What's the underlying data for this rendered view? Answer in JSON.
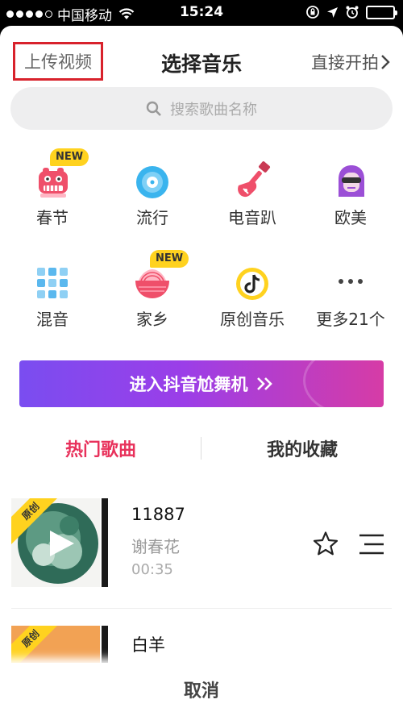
{
  "status_bar": {
    "carrier": "中国移动",
    "time": "15:24"
  },
  "header": {
    "upload_label": "上传视频",
    "title": "选择音乐",
    "direct_shoot_label": "直接开拍"
  },
  "search": {
    "placeholder": "搜索歌曲名称"
  },
  "categories": [
    {
      "label": "春节",
      "badge": "NEW",
      "icon": "lion-dance-icon"
    },
    {
      "label": "流行",
      "badge": "",
      "icon": "vinyl-record-icon"
    },
    {
      "label": "电音趴",
      "badge": "",
      "icon": "electric-guitar-icon"
    },
    {
      "label": "欧美",
      "badge": "",
      "icon": "masked-girl-icon"
    },
    {
      "label": "混音",
      "badge": "",
      "icon": "mixer-pads-icon"
    },
    {
      "label": "家乡",
      "badge": "NEW",
      "icon": "noodle-bowl-icon"
    },
    {
      "label": "原创音乐",
      "badge": "",
      "icon": "tiktok-note-icon"
    },
    {
      "label": "更多21个",
      "badge": "",
      "icon": "more-dots-icon"
    }
  ],
  "dance_banner": {
    "label": "进入抖音尬舞机"
  },
  "tabs": {
    "hot": "热门歌曲",
    "favorites": "我的收藏"
  },
  "songs": [
    {
      "ribbon": "原创",
      "name": "11887",
      "artist": "谢春花",
      "duration": "00:35"
    },
    {
      "ribbon": "原创",
      "name": "白羊",
      "artist": "",
      "duration": ""
    }
  ],
  "cancel_label": "取消",
  "colors": {
    "accent_red": "#e8315b",
    "badge_yellow": "#ffd21f",
    "banner_start": "#7a4df0",
    "banner_end": "#d63ca6",
    "highlight_box": "#d8222c"
  }
}
